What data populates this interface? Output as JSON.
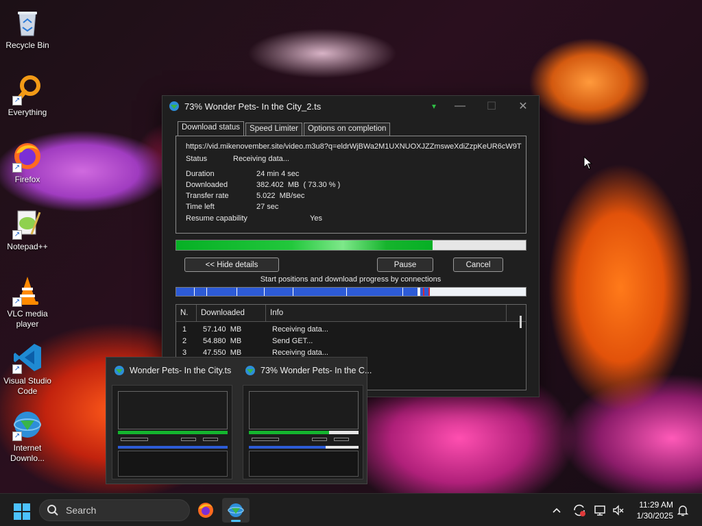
{
  "desktop": {
    "icons": [
      {
        "label": "Recycle Bin",
        "icon": "recycle-bin-icon"
      },
      {
        "label": "Everything",
        "icon": "everything-search-icon"
      },
      {
        "label": "Firefox",
        "icon": "firefox-icon"
      },
      {
        "label": "Notepad++",
        "icon": "notepadpp-icon"
      },
      {
        "label": "VLC media player",
        "icon": "vlc-icon"
      },
      {
        "label": "Visual Studio Code",
        "icon": "vscode-icon"
      },
      {
        "label": "Internet Downlo...",
        "icon": "idm-icon"
      }
    ]
  },
  "idm_window": {
    "title": "73% Wonder Pets- In the City_2.ts",
    "tabs": [
      "Download status",
      "Speed Limiter",
      "Options on completion"
    ],
    "url": "https://vid.mikenovember.site/video.m3u8?q=eldrWjBWa2M1UXNUOXJZZmsweXdiZzpKeUR6cW9TdH",
    "status_label": "Status",
    "status_value": "Receiving data...",
    "duration_label": "Duration",
    "duration_value": "24 min 4 sec",
    "downloaded_label": "Downloaded",
    "downloaded_value": "382.402  MB  ( 73.30 % )",
    "transfer_label": "Transfer rate",
    "transfer_value": "5.022  MB/sec",
    "timeleft_label": "Time left",
    "timeleft_value": "27 sec",
    "resume_label": "Resume capability",
    "resume_value": "Yes",
    "progress_percent": 73.3,
    "hide_details_label": "<< Hide details",
    "pause_label": "Pause",
    "cancel_label": "Cancel",
    "connections_caption": "Start positions and download progress by connections",
    "table": {
      "headers": [
        "N.",
        "Downloaded",
        "Info"
      ],
      "rows": [
        {
          "n": "1",
          "downloaded": "57.140  MB",
          "info": "Receiving data..."
        },
        {
          "n": "2",
          "downloaded": "54.880  MB",
          "info": "Send GET..."
        },
        {
          "n": "3",
          "downloaded": "47.550  MB",
          "info": "Receiving data..."
        }
      ]
    }
  },
  "thumbnail_popup": {
    "items": [
      {
        "title": "Wonder Pets- In the City.ts"
      },
      {
        "title": "73% Wonder Pets- In the C..."
      }
    ]
  },
  "taskbar": {
    "search_placeholder": "Search",
    "time": "11:29 AM",
    "date": "1/30/2025"
  }
}
